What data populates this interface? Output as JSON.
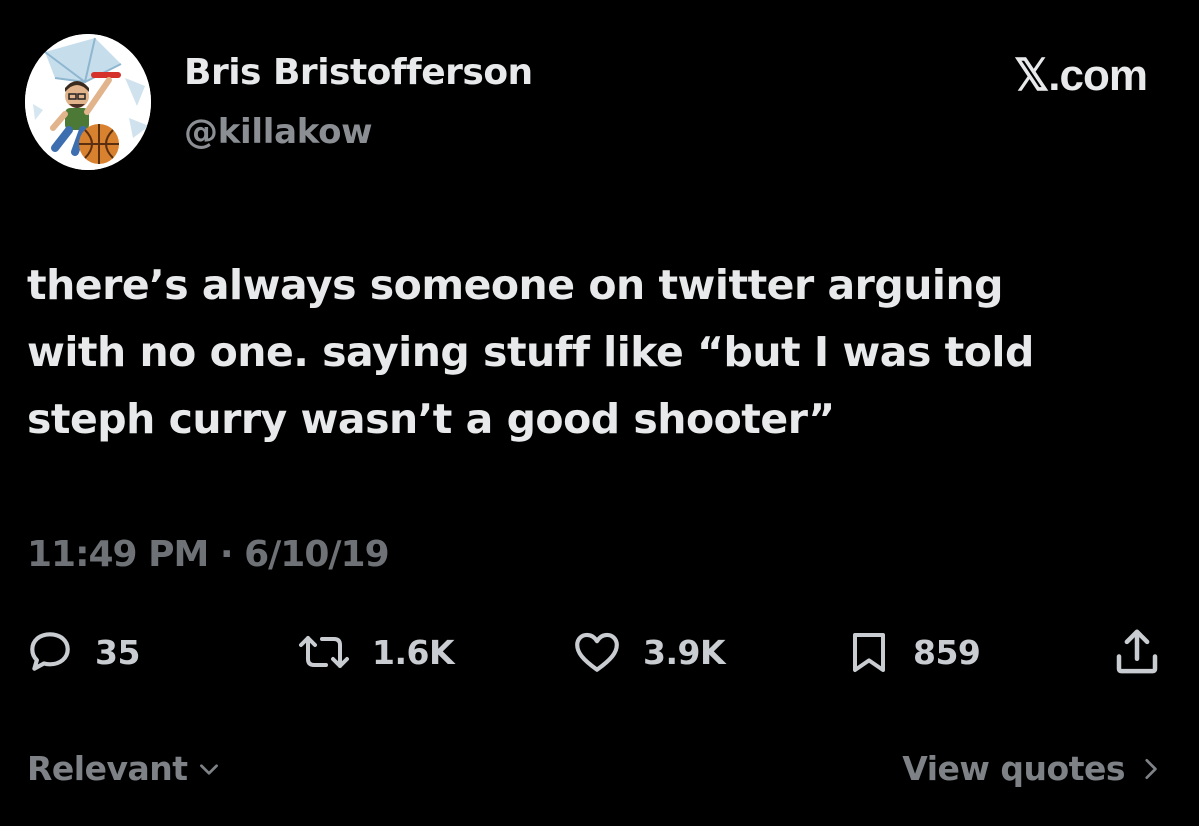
{
  "author": {
    "display_name": "Bris Bristofferson",
    "handle": "@killakow",
    "avatar_icon": "avatar-cartoon-basketball"
  },
  "brand": "𝕏.com",
  "tweet": {
    "lines": [
      "there’s always someone on twitter arguing",
      "with no one. saying stuff like “but I was told",
      "steph curry wasn’t a good shooter”"
    ],
    "timestamp": "11:49 PM · 6/10/19"
  },
  "actions": {
    "replies": {
      "icon": "reply-icon",
      "count": "35"
    },
    "reposts": {
      "icon": "repost-icon",
      "count": "1.6K"
    },
    "likes": {
      "icon": "heart-icon",
      "count": "3.9K"
    },
    "bookmarks": {
      "icon": "bookmark-icon",
      "count": "859"
    },
    "share": {
      "icon": "share-icon"
    }
  },
  "footer": {
    "sort_label": "Relevant",
    "view_quotes_label": "View quotes"
  },
  "colors": {
    "background": "#000000",
    "primary_text": "#e7e9ea",
    "secondary_text": "#6e7276"
  }
}
